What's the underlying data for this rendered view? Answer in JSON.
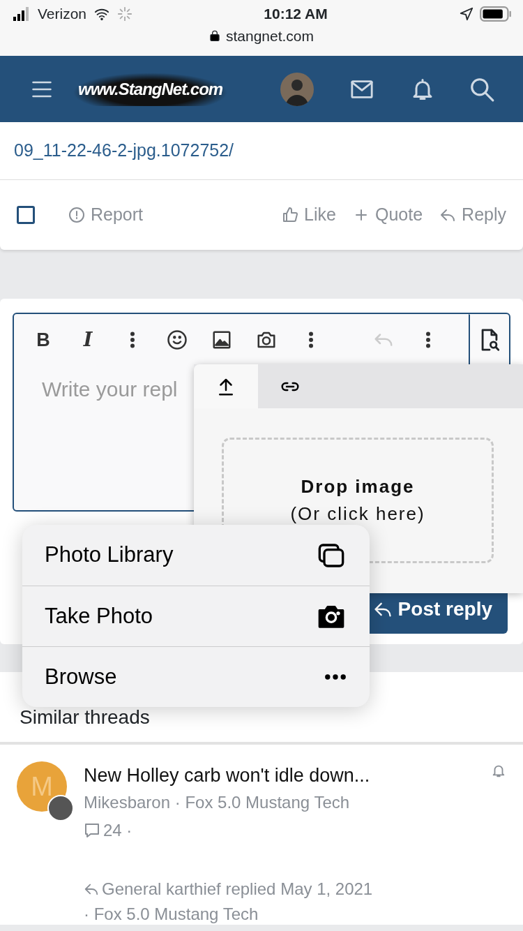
{
  "status_bar": {
    "carrier": "Verizon",
    "time": "10:12 AM",
    "url": "stangnet.com"
  },
  "header": {
    "logo": "www.StangNet.com"
  },
  "post": {
    "link_text": "09_11-22-46-2-jpg.1072752/",
    "checked": false,
    "report": "Report",
    "actions": [
      {
        "kind": "like",
        "label": "Like"
      },
      {
        "kind": "quote",
        "label": "Quote"
      },
      {
        "kind": "reply",
        "label": "Reply"
      }
    ]
  },
  "editor": {
    "toolbar": [
      {
        "kind": "bold",
        "label": "B",
        "disabled": false
      },
      {
        "kind": "italic",
        "label": "I",
        "disabled": false
      },
      {
        "kind": "more",
        "disabled": false
      },
      {
        "kind": "emoji",
        "disabled": false
      },
      {
        "kind": "image",
        "disabled": false
      },
      {
        "kind": "camera",
        "disabled": false
      },
      {
        "kind": "more",
        "disabled": false
      },
      {
        "kind": "undo",
        "disabled": true
      },
      {
        "kind": "more",
        "disabled": false
      }
    ],
    "placeholder": "Write your repl",
    "submit": "Post reply"
  },
  "upload_popup": {
    "tabs": [
      {
        "kind": "upload",
        "selected": true
      },
      {
        "kind": "link",
        "selected": false
      }
    ],
    "drop_title": "Drop image",
    "drop_hint": "(Or click here)"
  },
  "action_sheet": [
    {
      "kind": "library",
      "label": "Photo Library"
    },
    {
      "kind": "camera",
      "label": "Take Photo"
    },
    {
      "kind": "browse",
      "label": "Browse"
    }
  ],
  "similar": {
    "title": "Similar threads",
    "threads": [
      {
        "initial": "M",
        "color": "#e8a33a",
        "title": "New Holley carb won't idle down...",
        "byline": "Mikesbaron · Fox 5.0 Mustang Tech",
        "replies": "24 ·",
        "last": "General karthief replied May 1, 2021",
        "last_forum": "· Fox 5.0 Mustang Tech"
      }
    ]
  }
}
